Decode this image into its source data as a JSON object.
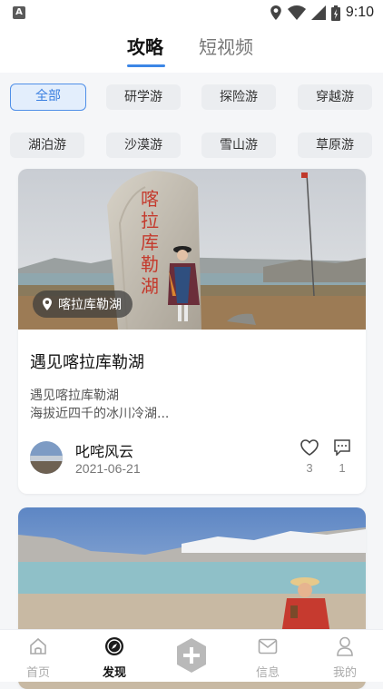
{
  "status_bar": {
    "time": "9:10"
  },
  "header": {
    "tabs": [
      {
        "label": "攻略"
      },
      {
        "label": "短视频"
      }
    ]
  },
  "categories": [
    {
      "label": "全部",
      "active": true
    },
    {
      "label": "研学游"
    },
    {
      "label": "探险游"
    },
    {
      "label": "穿越游"
    },
    {
      "label": "湖泊游"
    },
    {
      "label": "沙漠游"
    },
    {
      "label": "雪山游"
    },
    {
      "label": "草原游"
    }
  ],
  "posts": [
    {
      "location": "喀拉库勒湖",
      "stone_text": "喀拉库勒湖",
      "title": "遇见喀拉库勒湖",
      "desc_line1": "遇见喀拉库勒湖",
      "desc_line2": "海拔近四千的冰川冷湖...",
      "author": "叱咤风云",
      "date": "2021-06-21",
      "likes": "3",
      "comments": "1"
    }
  ],
  "bottom_nav": [
    {
      "label": "首页",
      "icon": "home-icon"
    },
    {
      "label": "发现",
      "icon": "compass-icon",
      "active": true
    },
    {
      "label": "",
      "icon": "plus-icon"
    },
    {
      "label": "信息",
      "icon": "mail-icon"
    },
    {
      "label": "我的",
      "icon": "user-icon"
    }
  ],
  "colors": {
    "accent": "#3c86e6",
    "chip_bg": "#ebedf0",
    "active_chip_bg": "#e3eefc"
  }
}
